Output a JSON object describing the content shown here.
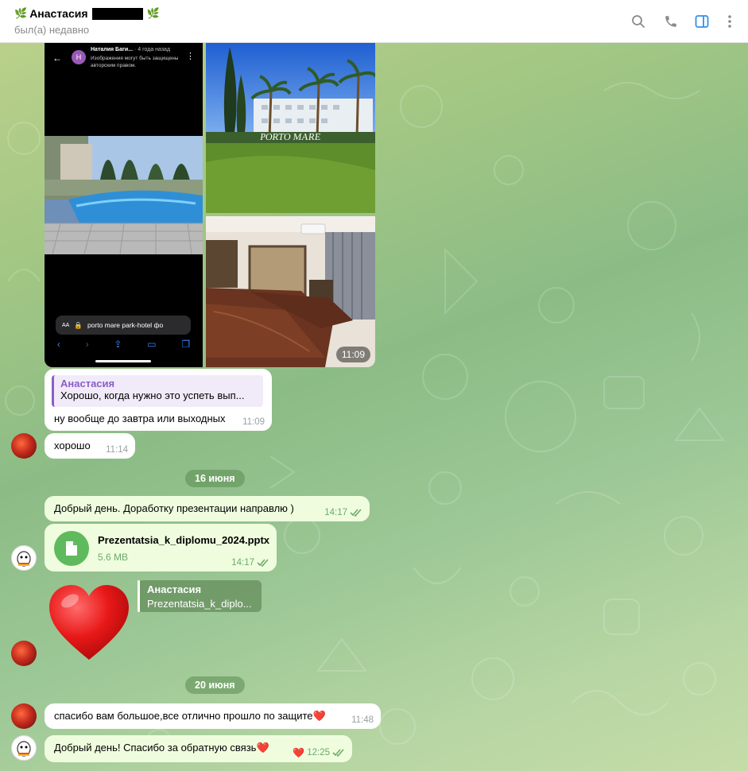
{
  "header": {
    "name_prefix": "🌿",
    "name": "Анастасия",
    "name_suffix": "🌿",
    "status": "был(а) недавно",
    "icons": [
      "search-icon",
      "phone-icon",
      "sidebar-toggle-icon",
      "more-icon"
    ]
  },
  "photo_group": {
    "screenshot": {
      "poster_initial": "Н",
      "poster_name": "Наталия Баги...",
      "poster_ago": "4 года назад",
      "notice_line1": "Изображения могут быть защищены",
      "notice_line2": "авторским правом.",
      "url_aa": "AA",
      "url": "porto mare park-hotel фо"
    },
    "hotel_sign": "PORTO MARE",
    "time": "11:09"
  },
  "messages": {
    "reply_msg": {
      "reply_author": "Анастасия",
      "reply_text": "Хорошо, когда нужно это успеть вып...",
      "text": "ну вообще до завтра или выходных",
      "time": "11:09"
    },
    "msg_ok": {
      "text": "хорошо",
      "time": "11:14"
    },
    "date1": "16 июня",
    "msg_day": {
      "text": "Добрый день. Доработку презентации направлю )",
      "time": "14:17"
    },
    "file_msg": {
      "name": "Prezentatsia_k_diplomu_2024.pptx",
      "size": "5.6 MB",
      "time": "14:17"
    },
    "sticker_reply": {
      "reply_author": "Анастасия",
      "reply_text": "Prezentatsia_k_diplo..."
    },
    "date2": "20 июня",
    "msg_thanks": {
      "text": "спасибо вам большое,все отлично прошло по защите",
      "emoji": "❤️",
      "time": "11:48"
    },
    "msg_reply2": {
      "text": "Добрый день! Спасибо за обратную связь",
      "emoji": "❤️",
      "reaction": "❤️",
      "time": "12:25"
    }
  },
  "colors": {
    "accent_purple": "#8b5dc8",
    "outgoing_bubble": "#effdde",
    "incoming_bubble": "#ffffff",
    "file_icon_green": "#5fba5d",
    "read_check_green": "#6caa6b"
  }
}
